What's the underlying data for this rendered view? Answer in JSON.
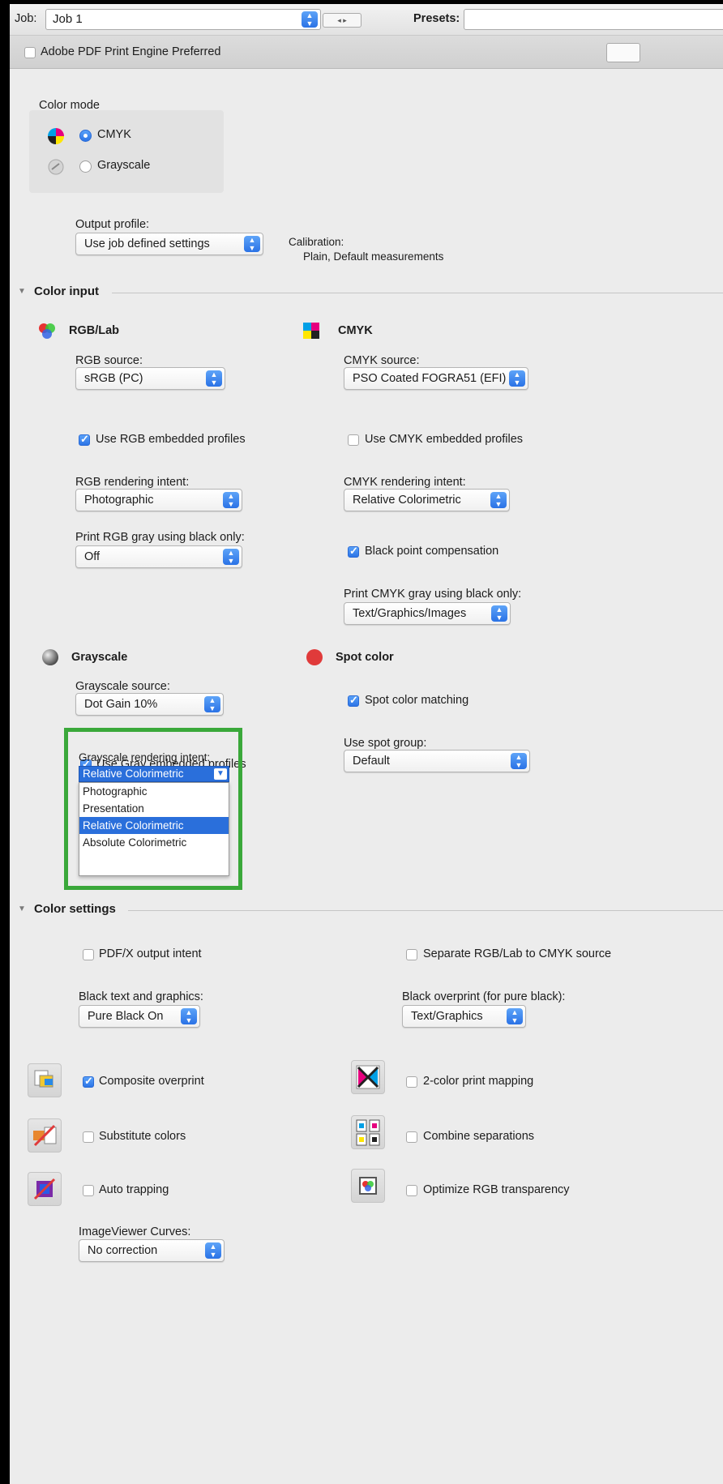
{
  "topbar": {
    "job_label": "Job:",
    "job_value": "Job 1",
    "presets_label": "Presets:",
    "presets_value": ""
  },
  "engine": {
    "checkbox_label": "Adobe PDF Print Engine Preferred",
    "checked": false
  },
  "color_mode": {
    "title": "Color mode",
    "options": [
      {
        "label": "CMYK",
        "selected": true
      },
      {
        "label": "Grayscale",
        "selected": false
      }
    ]
  },
  "output": {
    "profile_label": "Output profile:",
    "profile_value": "Use job defined settings",
    "calibration_label": "Calibration:",
    "calibration_value": "Plain, Default measurements"
  },
  "color_input": {
    "title": "Color input",
    "rgb": {
      "title": "RGB/Lab",
      "source_label": "RGB source:",
      "source_value": "sRGB (PC)",
      "embedded_label": "Use RGB embedded profiles",
      "embedded_checked": true,
      "intent_label": "RGB rendering intent:",
      "intent_value": "Photographic",
      "gray_label": "Print RGB gray using black only:",
      "gray_value": "Off"
    },
    "cmyk": {
      "title": "CMYK",
      "source_label": "CMYK source:",
      "source_value": "PSO Coated FOGRA51 (EFI)",
      "embedded_label": "Use CMYK embedded profiles",
      "embedded_checked": false,
      "intent_label": "CMYK rendering intent:",
      "intent_value": "Relative Colorimetric",
      "bpc_label": "Black point compensation",
      "bpc_checked": true,
      "gray_label": "Print CMYK gray using black only:",
      "gray_value": "Text/Graphics/Images"
    },
    "grayscale": {
      "title": "Grayscale",
      "source_label": "Grayscale source:",
      "source_value": "Dot Gain 10%",
      "embedded_label": "Use Gray embedded profiles",
      "embedded_checked": true,
      "intent_label": "Grayscale rendering intent:",
      "intent_value": "Relative Colorimetric",
      "intent_options": [
        "Photographic",
        "Presentation",
        "Relative Colorimetric",
        "Absolute Colorimetric"
      ],
      "highlight_color": "#3aa83a"
    },
    "spot": {
      "title": "Spot color",
      "matching_label": "Spot color matching",
      "matching_checked": true,
      "group_label": "Use spot group:",
      "group_value": "Default"
    }
  },
  "color_settings": {
    "title": "Color settings",
    "pdfx_label": "PDF/X output intent",
    "separate_label": "Separate RGB/Lab to CMYK source",
    "black_text_label": "Black text and graphics:",
    "black_text_value": "Pure Black On",
    "black_overprint_label": "Black overprint (for pure black):",
    "black_overprint_value": "Text/Graphics",
    "composite_label": "Composite overprint",
    "composite_checked": true,
    "two_color_label": "2-color print mapping",
    "substitute_label": "Substitute colors",
    "combine_label": "Combine separations",
    "auto_trapping_label": "Auto trapping",
    "optimize_label": "Optimize RGB transparency",
    "curves_label": "ImageViewer Curves:",
    "curves_value": "No correction"
  },
  "colors": {
    "accent": "#2c74e6",
    "highlight_box": "#3aa83a",
    "spot_red": "#e03a3a"
  }
}
